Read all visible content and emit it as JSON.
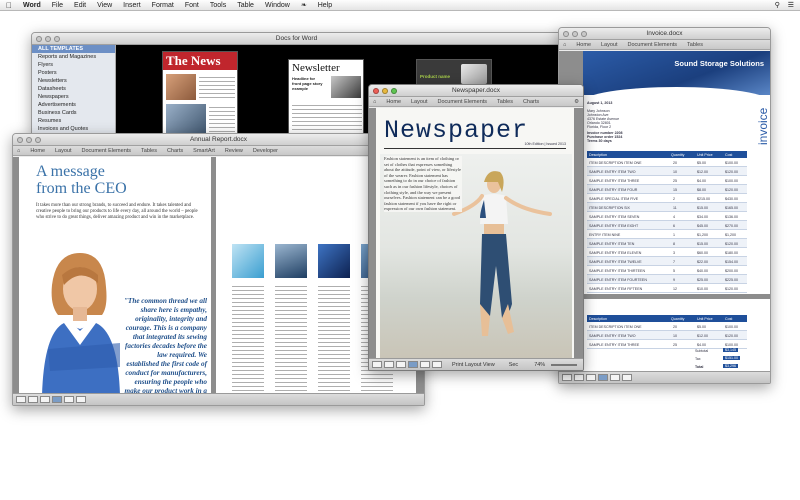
{
  "menubar": {
    "items": [
      "Word",
      "File",
      "Edit",
      "View",
      "Insert",
      "Format",
      "Font",
      "Tools",
      "Table",
      "Window",
      "Help"
    ]
  },
  "gallery": {
    "title": "Docs for Word",
    "categories": [
      "ALL TEMPLATES",
      "Reports and Magazines",
      "Flyers",
      "Posters",
      "Newsletters",
      "Datasheets",
      "Newspapers",
      "Advertisements",
      "Business Cards",
      "Resumes",
      "Invoices and Quotes"
    ],
    "thumb_news_title": "The News",
    "thumb_newsletter_title": "Newsletter",
    "thumb_newsletter_sub": "Headline for front page story example",
    "thumb_product_name": "Product name"
  },
  "annual": {
    "title": "Annual Report.docx",
    "ribbon": [
      "Home",
      "Layout",
      "Document Elements",
      "Tables",
      "Charts",
      "SmartArt",
      "Review",
      "Developer"
    ],
    "heading_line1": "A message",
    "heading_line2": "from the CEO",
    "intro": "It takes more than our strong brands, to succeed and endure. It takes talented and creative people to bring our products to life every day, all around the world – people who strive to do great things, deliver amazing product and win in the marketplace.",
    "quote": "\"The common thread we all share here is empathy, originality, integrity and courage. This is a company that integrated its sewing factories decades before the law required. We established the first code of conduct for manufacturers, ensuring the people who make our product work in a safe environment and are treated with dignity and respect.\""
  },
  "newspaper": {
    "title": "Newspaper.docx",
    "ribbon": [
      "Home",
      "Layout",
      "Document Elements",
      "Tables",
      "Charts"
    ],
    "masthead": "Newspaper",
    "edition": "10th Edition | Issued 2013",
    "body": "Fashion statement is an item of clothing or set of clothes that expresses something about the attitude, point of view, or lifestyle of the wearer. Fashion statement has something to do in our choice of fashion such as in our fashion lifestyle, choices of clothing style, and the way we present ourselves. Fashion statement can be a good fashion statement if you have the right or expression of our own fashion statement.",
    "status_view": "Print Layout View",
    "status_sec": "Sec",
    "zoom": "74%"
  },
  "invoice": {
    "title": "Invoice.docx",
    "ribbon": [
      "Home",
      "Layout",
      "Document Elements",
      "Tables"
    ],
    "company": "Sound Storage Solutions",
    "word": "invoice",
    "date": "August 1, 2013",
    "customer": [
      "Mary Johnson",
      "Johnston Ave",
      "4376 Estate Avenue",
      "Orlando 32801",
      "Florida, Floor 2"
    ],
    "meta": [
      [
        "Invoice number",
        "2208"
      ],
      [
        "Purchase order",
        "1524"
      ],
      [
        "Terms",
        "30 days"
      ]
    ],
    "columns": [
      "Description",
      "Quantity",
      "Unit Price",
      "Cost"
    ],
    "rows": [
      [
        "ITEM DESCRIPTION ITEM ONE",
        "20",
        "$5.00",
        "$100.00"
      ],
      [
        "SAMPLE ENTRY ITEM TWO",
        "10",
        "$12.00",
        "$120.00"
      ],
      [
        "SAMPLE ENTRY ITEM THREE",
        "25",
        "$4.00",
        "$100.00"
      ],
      [
        "SAMPLE ENTRY ITEM FOUR",
        "15",
        "$8.00",
        "$120.00"
      ],
      [
        "SAMPLE SPECIAL ITEM FIVE",
        "2",
        "$215.00",
        "$430.00"
      ],
      [
        "ITEM DESCRIPTION SIX",
        "11",
        "$15.00",
        "$165.00"
      ],
      [
        "SAMPLE ENTRY ITEM SEVEN",
        "4",
        "$34.00",
        "$136.00"
      ],
      [
        "SAMPLE ENTRY ITEM EIGHT",
        "6",
        "$45.00",
        "$270.00"
      ],
      [
        "ENTRY ITEM NINE",
        "1",
        "$1,200",
        "$1,200"
      ],
      [
        "SAMPLE ENTRY ITEM TEN",
        "8",
        "$15.00",
        "$120.00"
      ],
      [
        "SAMPLE ENTRY ITEM ELEVEN",
        "3",
        "$60.00",
        "$180.00"
      ],
      [
        "SAMPLE ENTRY ITEM TWELVE",
        "7",
        "$22.00",
        "$154.00"
      ],
      [
        "SAMPLE ENTRY ITEM THIRTEEN",
        "5",
        "$40.00",
        "$200.00"
      ],
      [
        "SAMPLE ENTRY ITEM FOURTEEN",
        "9",
        "$25.00",
        "$225.00"
      ],
      [
        "SAMPLE ENTRY ITEM FIFTEEN",
        "12",
        "$10.00",
        "$120.00"
      ]
    ],
    "page2_rows": [
      [
        "ITEM DESCRIPTION ITEM ONE",
        "20",
        "$5.00",
        "$100.00"
      ],
      [
        "SAMPLE ENTRY ITEM TWO",
        "10",
        "$12.00",
        "$120.00"
      ],
      [
        "SAMPLE ENTRY ITEM THREE",
        "25",
        "$4.00",
        "$100.00"
      ]
    ],
    "totals": [
      [
        "Subtotal",
        "$3,145"
      ],
      [
        "Tax",
        "$151.00"
      ],
      [
        "Total",
        "$3,296"
      ]
    ]
  }
}
